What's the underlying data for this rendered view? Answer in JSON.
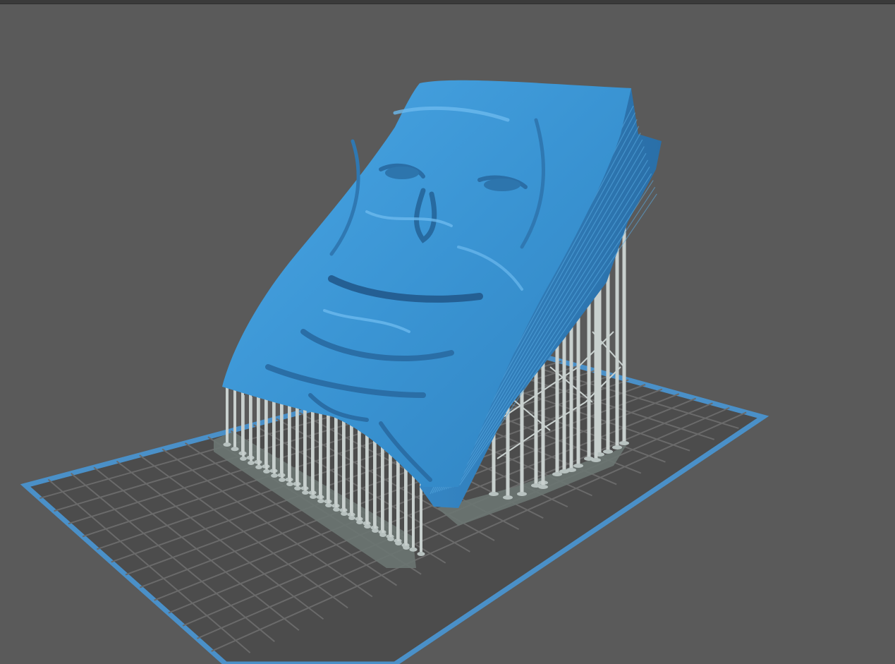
{
  "app": {
    "view": "3d-viewport",
    "subject": "model-with-supports"
  },
  "colors": {
    "background": "#5a5a5a",
    "build_plate_fill": "#4d4d4d",
    "build_plate_grid": "#707070",
    "build_plate_border": "#4a90c8",
    "model": "#3d97d6",
    "model_shadow": "#2c6fa6",
    "model_highlight": "#6cb9ee",
    "supports": "#c8d0ce",
    "support_shadow": "#98a4a2",
    "raft": "#6c7572"
  },
  "icons": {
    "viewport": "3d-canvas"
  }
}
